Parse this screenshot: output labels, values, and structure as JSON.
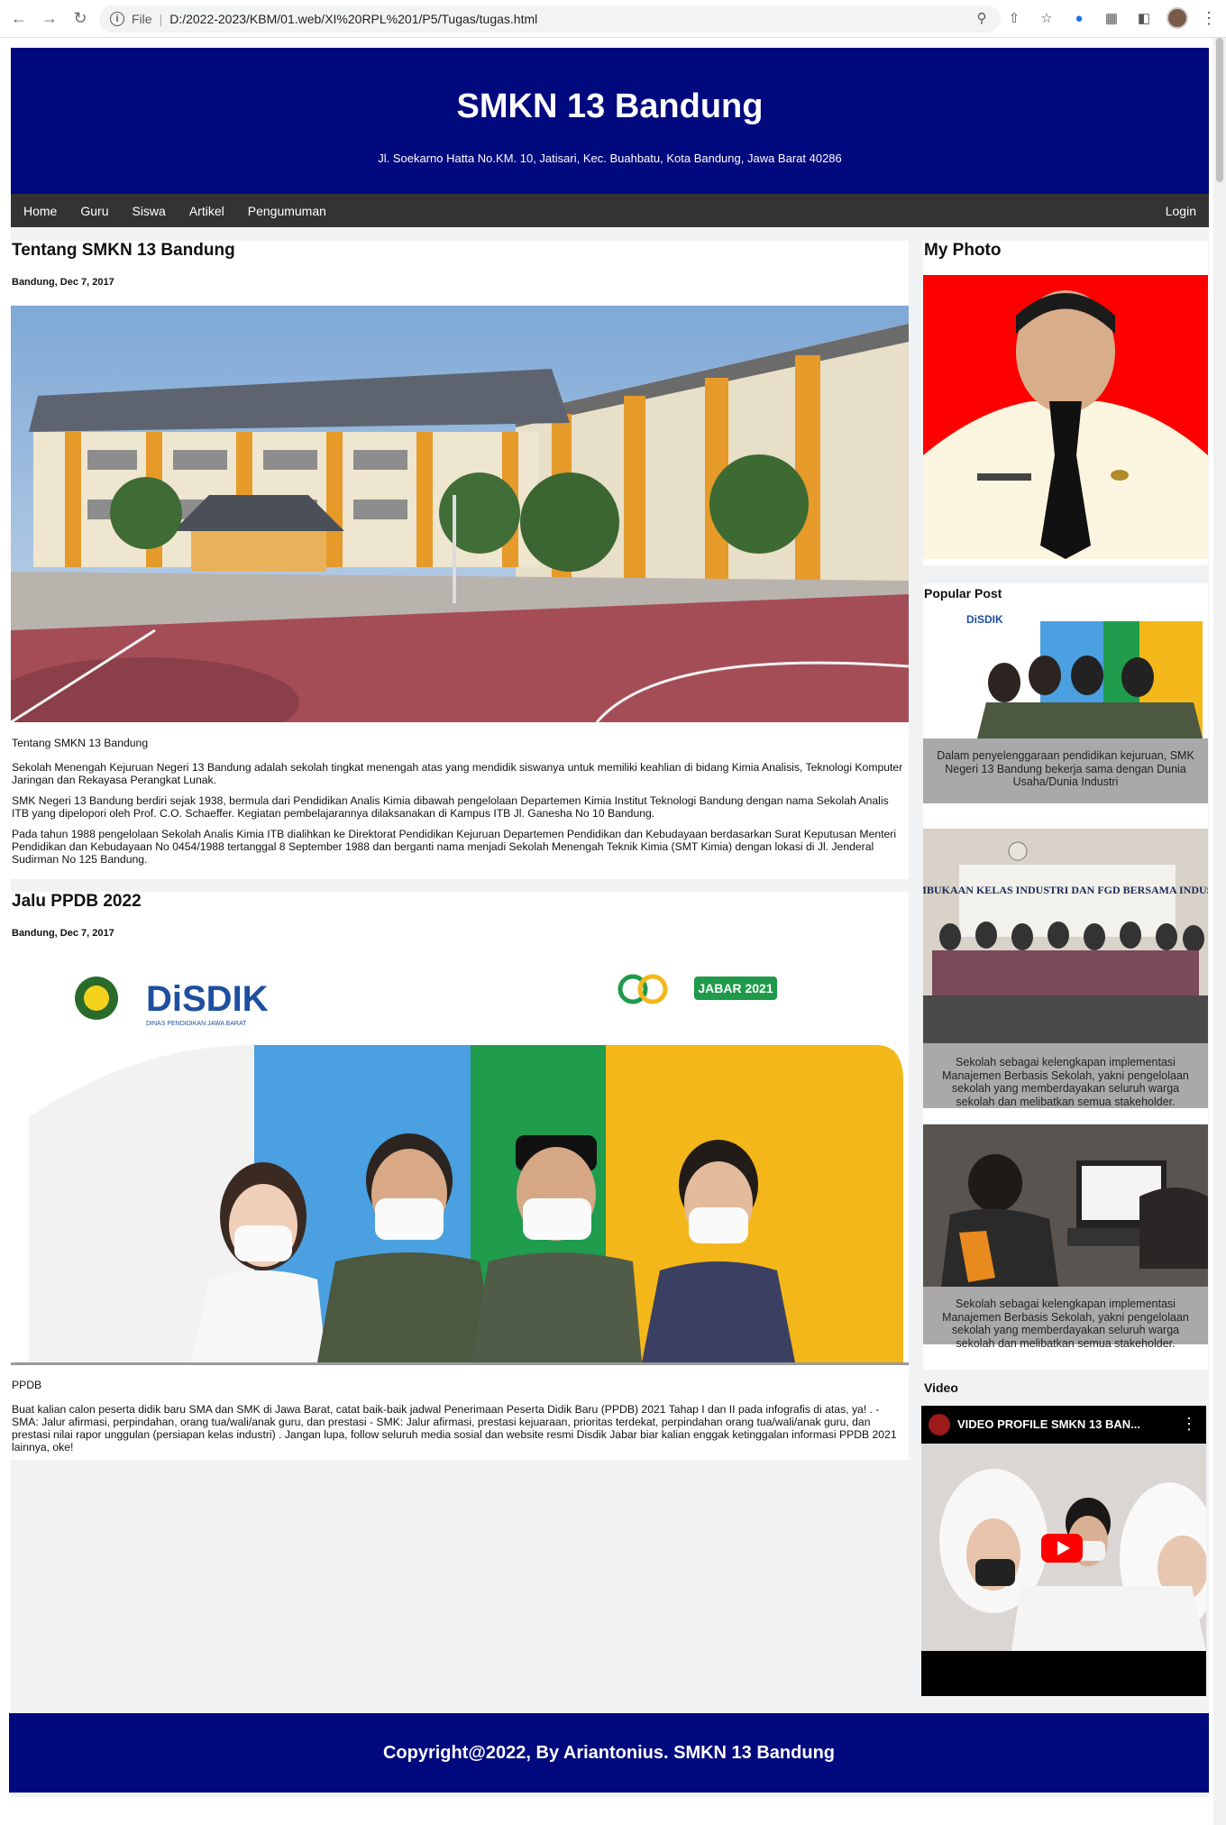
{
  "browser": {
    "url_label": "File",
    "url": "D:/2022-2023/KBM/01.web/XI%20RPL%201/P5/Tugas/tugas.html"
  },
  "header": {
    "title": "SMKN 13 Bandung",
    "address": "Jl. Soekarno Hatta No.KM. 10, Jatisari, Kec. Buahbatu, Kota Bandung, Jawa Barat 40286"
  },
  "nav": {
    "items": [
      "Home",
      "Guru",
      "Siswa",
      "Artikel",
      "Pengumuman"
    ],
    "login": "Login"
  },
  "posts": [
    {
      "title": "Tentang SMKN 13 Bandung",
      "date": "Bandung, Dec 7, 2017",
      "caption": "Tentang SMKN 13 Bandung",
      "paragraphs": [
        "Sekolah Menengah Kejuruan Negeri 13 Bandung adalah sekolah tingkat menengah atas yang mendidik siswanya untuk memiliki keahlian di bidang Kimia Analisis, Teknologi Komputer Jaringan dan Rekayasa Perangkat Lunak.",
        "SMK Negeri 13 Bandung berdiri sejak 1938, bermula dari Pendidikan Analis Kimia dibawah pengelolaan Departemen Kimia Institut Teknologi Bandung dengan nama Sekolah Analis ITB yang dipelopori oleh Prof. C.O. Schaeffer. Kegiatan pembelajarannya dilaksanakan di Kampus ITB Jl. Ganesha No 10 Bandung.",
        "Pada tahun 1988 pengelolaan Sekolah Analis Kimia ITB dialihkan ke Direktorat Pendidikan Kejuruan Departemen Pendidikan dan Kebudayaan berdasarkan Surat Keputusan Menteri Pendidikan dan Kebudayaan No 0454/1988 tertanggal 8 September 1988 dan berganti nama menjadi Sekolah Menengah Teknik Kimia (SMT Kimia) dengan lokasi di Jl. Jenderal Sudirman No 125 Bandung."
      ]
    },
    {
      "title": "Jalu PPDB 2022",
      "date": "Bandung, Dec 7, 2017",
      "caption": "PPDB",
      "paragraphs": [
        "Buat kalian calon peserta didik baru SMA dan SMK di Jawa Barat, catat baik-baik jadwal Penerimaan Peserta Didik Baru (PPDB) 2021 Tahap I dan II pada infografis di atas, ya! . - SMA: Jalur afirmasi, perpindahan, orang tua/wali/anak guru, dan prestasi - SMK: Jalur afirmasi, prestasi kejuaraan, prioritas terdekat, perpindahan orang tua/wali/anak guru, dan prestasi nilai rapor unggulan (persiapan kelas industri) . Jangan lupa, follow seluruh media sosial dan website resmi Disdik Jabar biar kalian enggak ketinggalan informasi PPDB 2021 lainnya, oke!"
      ],
      "banner": {
        "brand": "DiSDIK",
        "brand_sub": "DINAS PENDIDIKAN JAWA BARAT",
        "tag": "JABAR 2021"
      }
    }
  ],
  "sidebar": {
    "photo_title": "My Photo",
    "popular_title": "Popular Post",
    "popular": [
      {
        "caption": "Dalam penyelenggaraan pendidikan kejuruan, SMK Negeri 13 Bandung bekerja sama dengan Dunia Usaha/Dunia Industri"
      },
      {
        "caption": "Sekolah sebagai kelengkapan implementasi Manajemen Berbasis Sekolah, yakni pengelolaan sekolah yang memberdayakan seluruh warga sekolah dan melibatkan semua stakeholder.",
        "banner": "PEMBUKAAN KELAS INDUSTRI DAN FGD BERSAMA INDUSTRI"
      },
      {
        "caption": "Sekolah sebagai kelengkapan implementasi Manajemen Berbasis Sekolah, yakni pengelolaan sekolah yang memberdayakan seluruh warga sekolah dan melibatkan semua stakeholder."
      }
    ],
    "video_title": "Video",
    "video_label": "VIDEO PROFILE SMKN 13 BAN..."
  },
  "footer": {
    "text": "Copyright@2022, By Ariantonius. SMKN 13 Bandung"
  }
}
